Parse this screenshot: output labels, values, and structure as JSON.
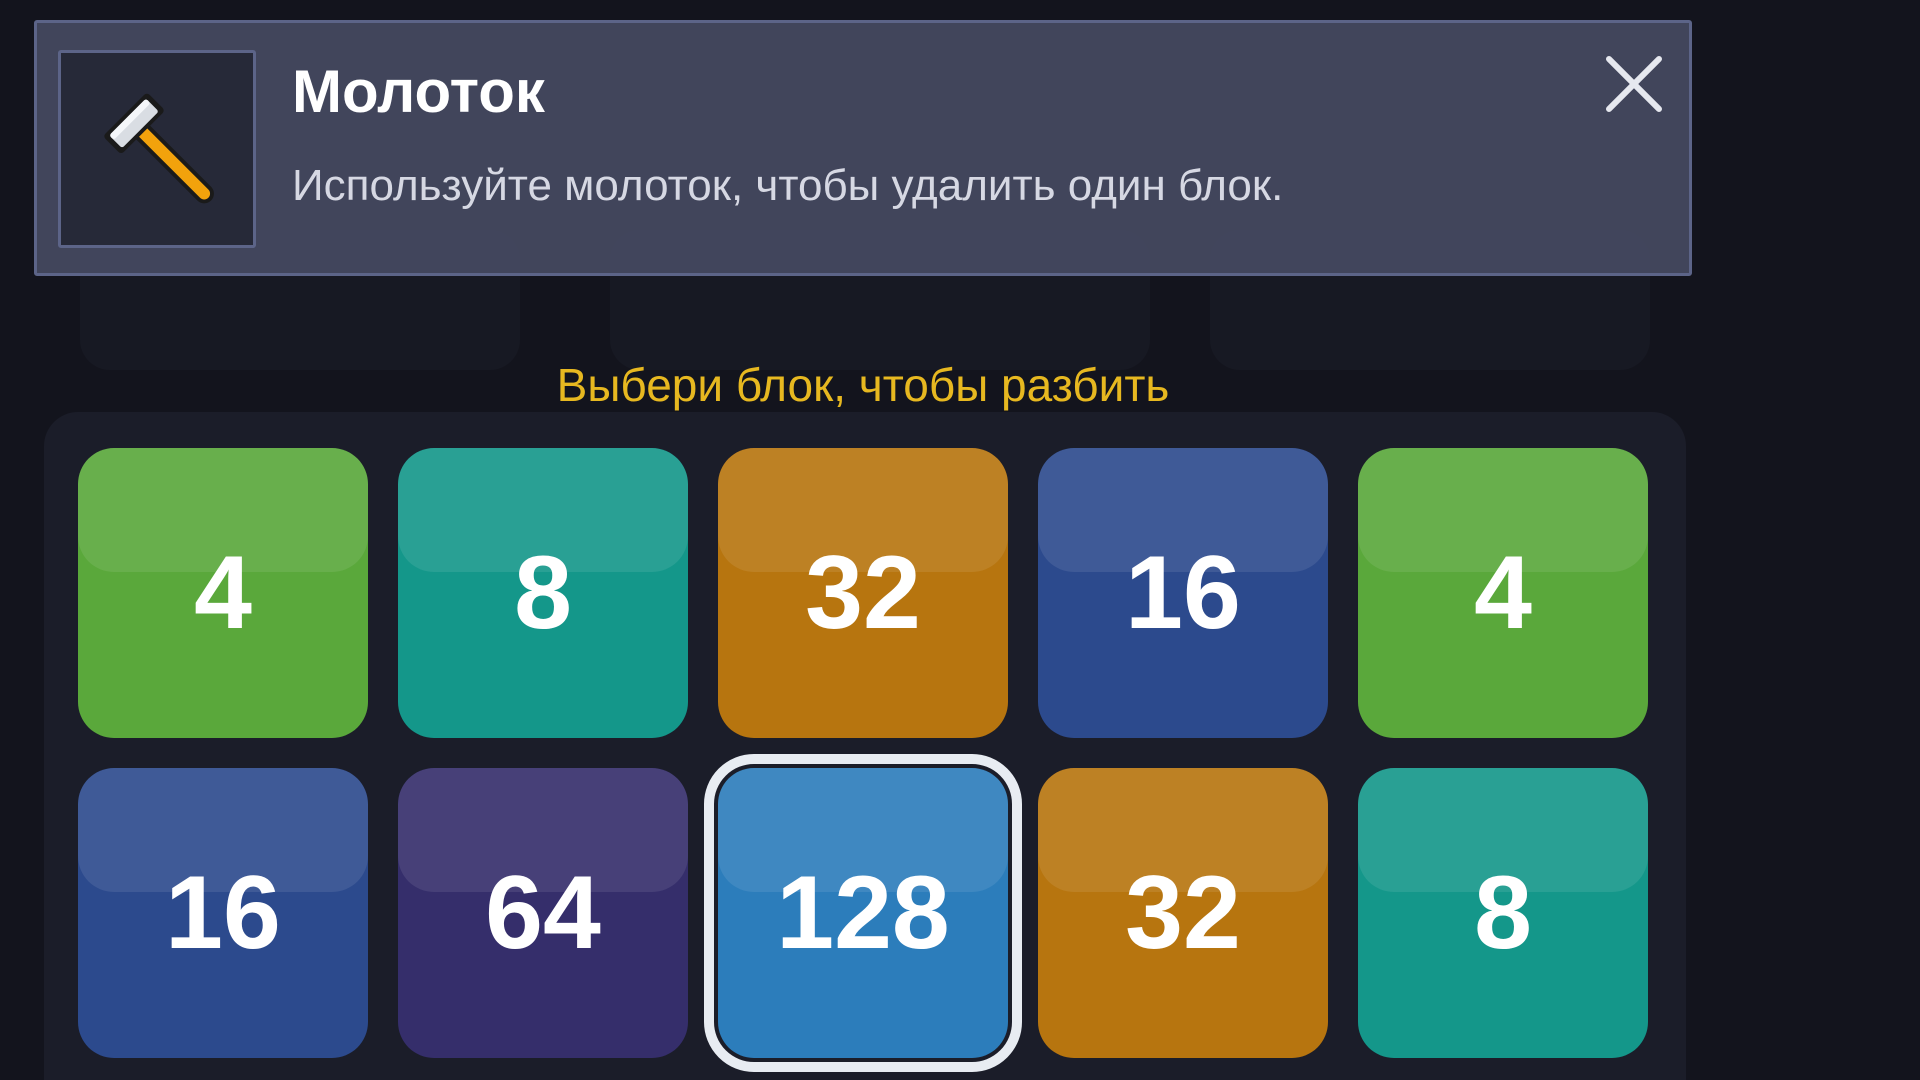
{
  "tooltip": {
    "title": "Молоток",
    "description": "Используйте молоток, чтобы удалить один блок.",
    "icon": "hammer-icon",
    "close_icon": "close-icon"
  },
  "hint": "Выбери блок, чтобы разбить",
  "board": {
    "tiles": [
      {
        "value": "4",
        "color": "#5aa83b"
      },
      {
        "value": "8",
        "color": "#14978a"
      },
      {
        "value": "32",
        "color": "#b7750f"
      },
      {
        "value": "16",
        "color": "#2c4a8d"
      },
      {
        "value": "4",
        "color": "#5aa83b"
      },
      {
        "value": "16",
        "color": "#2c4a8d"
      },
      {
        "value": "64",
        "color": "#352e6b"
      },
      {
        "value": "128",
        "color": "#2c7dbb",
        "selected": true
      },
      {
        "value": "32",
        "color": "#b7750f"
      },
      {
        "value": "8",
        "color": "#14978a"
      }
    ]
  },
  "colors": {
    "background": "#13141d",
    "hint": "#e7b820",
    "selection_outline": "#e8ecf2"
  }
}
